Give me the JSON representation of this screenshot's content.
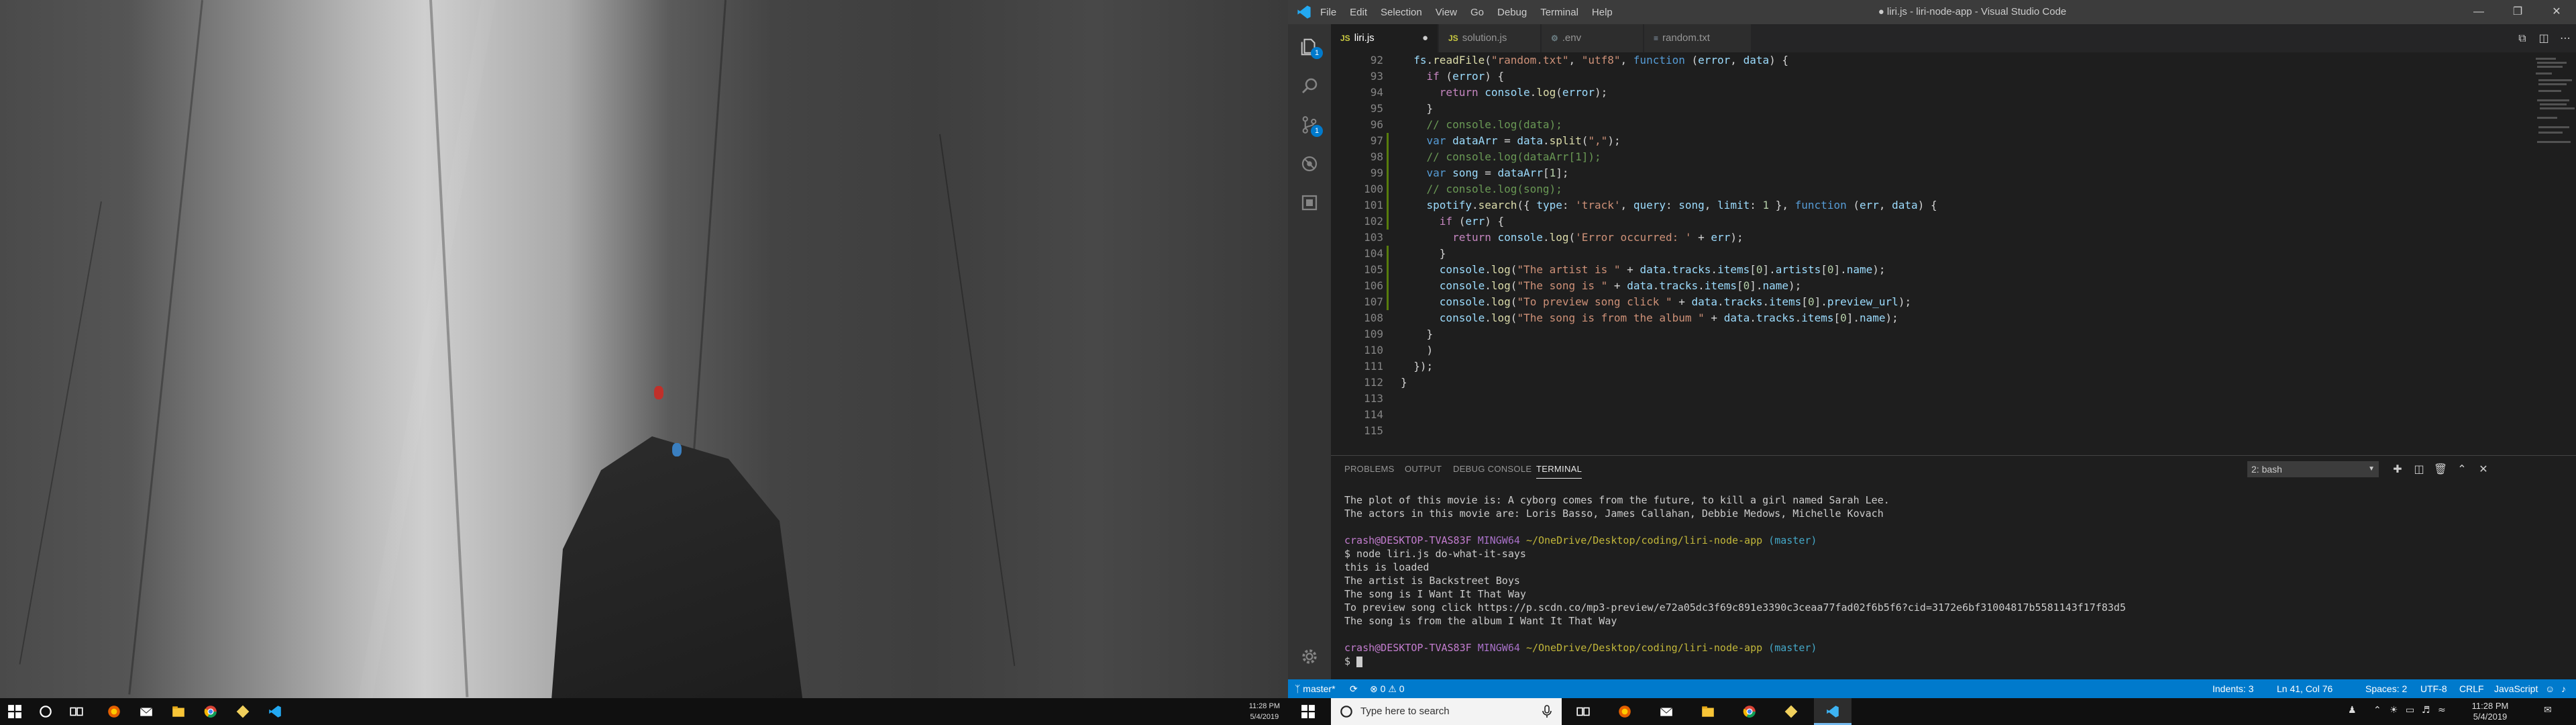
{
  "left_taskbar": {
    "time": "11:28 PM",
    "date": "5/4/2019"
  },
  "titlebar": {
    "menu": [
      "File",
      "Edit",
      "Selection",
      "View",
      "Go",
      "Debug",
      "Terminal",
      "Help"
    ],
    "title": "● liri.js - liri-node-app - Visual Studio Code"
  },
  "activity_badges": {
    "explorer": "1",
    "scm": "1"
  },
  "tabs": [
    {
      "icon": "JS",
      "label": "liri.js",
      "modified": "●"
    },
    {
      "icon": "JS",
      "label": "solution.js"
    },
    {
      "icon": "⚙",
      "label": ".env"
    },
    {
      "icon": "≡",
      "label": "random.txt"
    }
  ],
  "editor": {
    "line_numbers": [
      "92",
      "93",
      "94",
      "95",
      "96",
      "97",
      "98",
      "99",
      "100",
      "101",
      "102",
      "103",
      "104",
      "105",
      "106",
      "107",
      "108",
      "109",
      "110",
      "111",
      "112",
      "113",
      "114",
      "115"
    ]
  },
  "panel": {
    "tabs": [
      "PROBLEMS",
      "OUTPUT",
      "DEBUG CONSOLE",
      "TERMINAL"
    ],
    "terminal_select": "2: bash",
    "terminal_lines": {
      "l1": "The plot of this movie is: A cyborg comes from the future, to kill a girl named Sarah Lee.",
      "l2": "The actors in this movie are: Loris Basso, James Callahan, Debbie Medows, Michelle Kovach",
      "prompt_user": "crash@DESKTOP-TVAS83F",
      "prompt_env": "MINGW64",
      "prompt_path": "~/OneDrive/Desktop/coding/liri-node-app",
      "prompt_branch": "(master)",
      "command": "$ node liri.js do-what-it-says",
      "o1": "this is loaded",
      "o2": "The artist is Backstreet Boys",
      "o3": "The song is I Want It That Way",
      "o4": "To preview song click https://p.scdn.co/mp3-preview/e72a05dc3f69c891e3390c3ceaa77fad02f6b5f6?cid=3172e6bf31004817b5581143f17f83d5",
      "o5": "The song is from the album I Want It That Way",
      "final_prompt": "$"
    }
  },
  "statusbar": {
    "branch": "master*",
    "sync": "⟳",
    "errors": "⊗ 0",
    "warnings": "⚠ 0",
    "indent": "Indents: 3",
    "position": "Ln 41, Col 76",
    "spaces": "Spaces: 2",
    "encoding": "UTF-8",
    "eol": "CRLF",
    "language": "JavaScript"
  },
  "right_taskbar": {
    "search_placeholder": "Type here to search",
    "time": "11:28 PM",
    "date": "5/4/2019"
  }
}
